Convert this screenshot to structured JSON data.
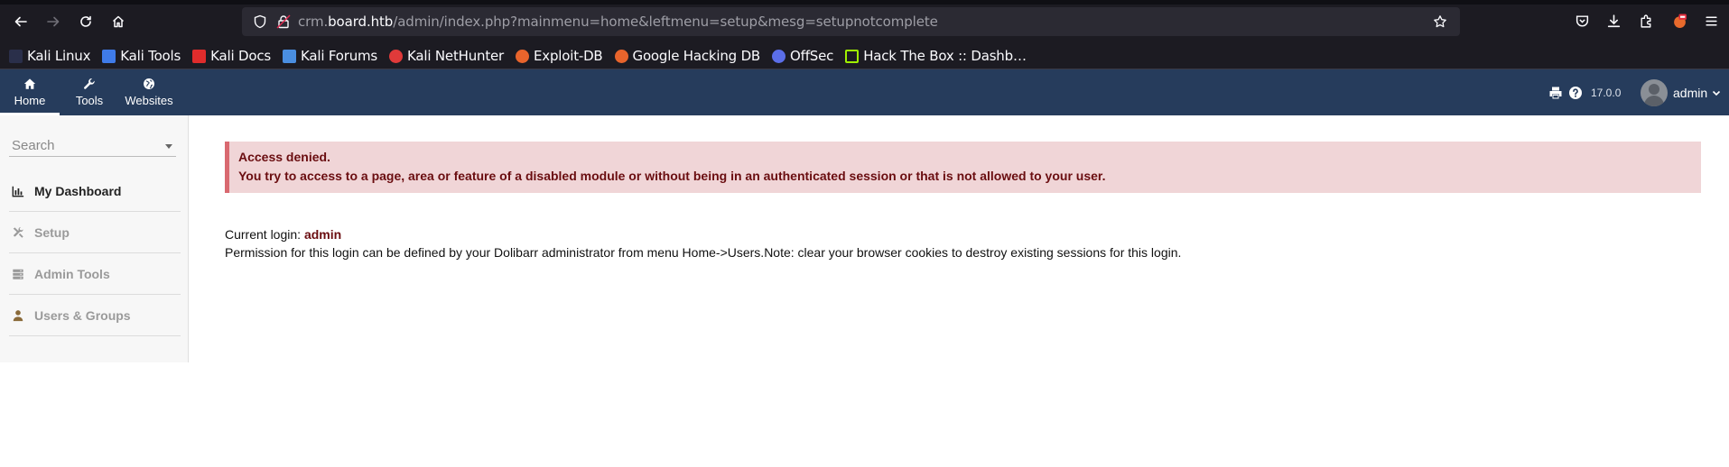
{
  "browser": {
    "url_prefix": "crm.",
    "url_host": "board.htb",
    "url_rest": "/admin/index.php?mainmenu=home&leftmenu=setup&mesg=setupnotcomplete",
    "bookmarks": [
      {
        "label": "Kali Linux",
        "icon": "kali-linux-icon",
        "color": "#4a8ee0"
      },
      {
        "label": "Kali Tools",
        "icon": "kali-tools-icon",
        "color": "#3f7be8"
      },
      {
        "label": "Kali Docs",
        "icon": "kali-docs-icon",
        "color": "#e02c2c"
      },
      {
        "label": "Kali Forums",
        "icon": "kali-forums-icon",
        "color": "#4a8ee0"
      },
      {
        "label": "Kali NetHunter",
        "icon": "kali-nethunter-icon",
        "color": "#e03a3a"
      },
      {
        "label": "Exploit-DB",
        "icon": "exploit-db-icon",
        "color": "#e8642c"
      },
      {
        "label": "Google Hacking DB",
        "icon": "google-hacking-db-icon",
        "color": "#e8642c"
      },
      {
        "label": "OffSec",
        "icon": "offsec-icon",
        "color": "#5b6ee8"
      },
      {
        "label": "Hack The Box :: Dashb…",
        "icon": "hack-the-box-icon",
        "color": "#9fef00"
      }
    ]
  },
  "topbar": {
    "menus": [
      {
        "label": "Home",
        "icon": "home-icon"
      },
      {
        "label": "Tools",
        "icon": "wrench-icon"
      },
      {
        "label": "Websites",
        "icon": "globe-icon"
      }
    ],
    "version": "17.0.0",
    "user": "admin"
  },
  "leftmenu": {
    "search_placeholder": "Search",
    "items": [
      {
        "label": "My Dashboard",
        "icon": "chart-icon"
      },
      {
        "label": "Setup",
        "icon": "tools-icon"
      },
      {
        "label": "Admin Tools",
        "icon": "server-icon"
      },
      {
        "label": "Users & Groups",
        "icon": "user-icon"
      }
    ]
  },
  "main": {
    "error_title": "Access denied.",
    "error_message": "You try to access to a page, area or feature of a disabled module or without being in an authenticated session or that is not allowed to your user.",
    "current_login_label": "Current login: ",
    "current_login_value": "admin",
    "permission_text": "Permission for this login can be defined by your Dolibarr administrator from menu Home->Users.Note: clear your browser cookies to destroy existing sessions for this login."
  }
}
